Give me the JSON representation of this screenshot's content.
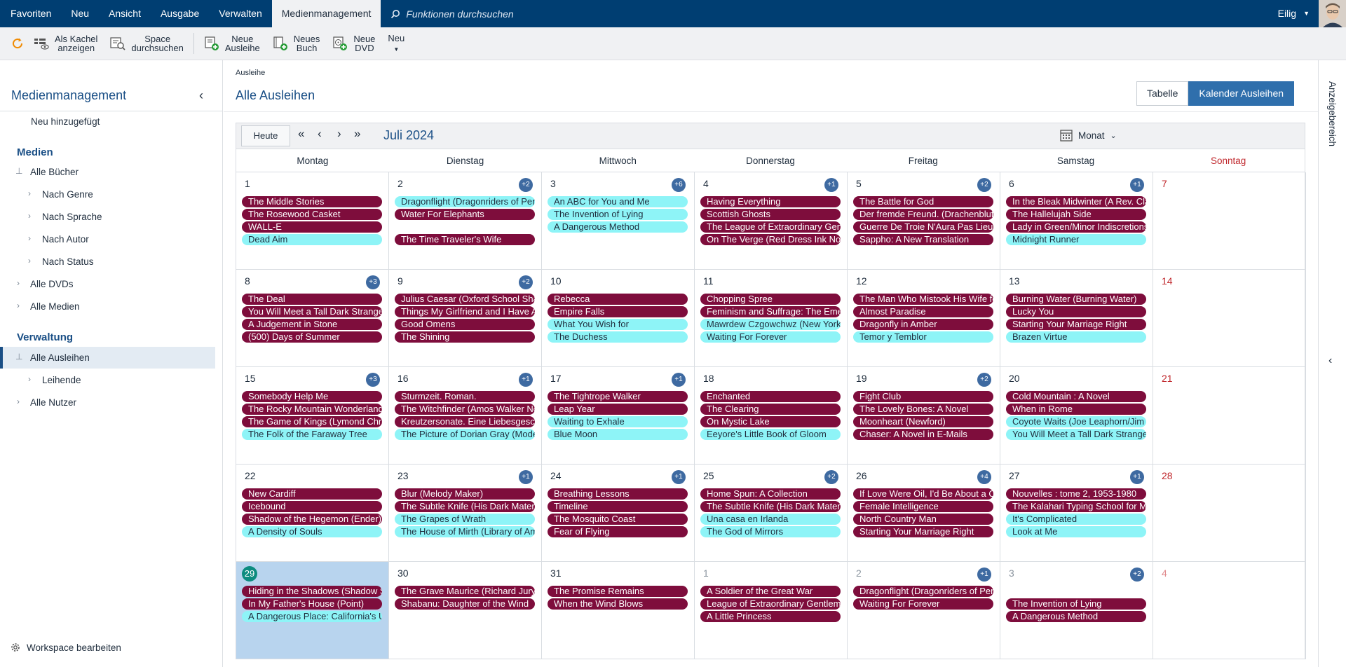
{
  "topnav": {
    "items": [
      "Favoriten",
      "Neu",
      "Ansicht",
      "Ausgabe",
      "Verwalten",
      "Medienmanagement"
    ],
    "active_index": 5,
    "search_placeholder": "Funktionen durchsuchen",
    "user": "Eilig"
  },
  "ribbon": {
    "refresh_icon": "refresh-icon",
    "tile_view": "Als Kachel\nanzeigen",
    "space_search": "Space\ndurchsuchen",
    "new_loan": "Neue\nAusleihe",
    "new_book": "Neues\nBuch",
    "new_dvd": "Neue\nDVD",
    "new_menu": "Neu"
  },
  "sidebar": {
    "title": "Medienmanagement",
    "recent": "Neu hinzugefügt",
    "media_heading": "Medien",
    "all_books": "Alle Bücher",
    "by_genre": "Nach Genre",
    "by_language": "Nach Sprache",
    "by_author": "Nach Autor",
    "by_status": "Nach Status",
    "all_dvds": "Alle DVDs",
    "all_media": "Alle Medien",
    "admin_heading": "Verwaltung",
    "all_loans": "Alle Ausleihen",
    "borrowers": "Leihende",
    "all_users": "Alle Nutzer",
    "footer": "Workspace bearbeiten"
  },
  "main": {
    "breadcrumb": "Ausleihe",
    "title": "Alle Ausleihen",
    "view_table": "Tabelle",
    "view_calendar": "Kalender Ausleihen"
  },
  "calendar": {
    "today_button": "Heute",
    "month_label": "Juli 2024",
    "view_select": "Monat",
    "weekdays": [
      "Montag",
      "Dienstag",
      "Mittwoch",
      "Donnerstag",
      "Freitag",
      "Samstag",
      "Sonntag"
    ],
    "colors": {
      "dark": "#7e0d3c",
      "light": "#8ef4f7",
      "today_bg": "#b8d4ee",
      "sunday": "#c0282d"
    },
    "weeks": [
      [
        {
          "day": "1",
          "events": [
            {
              "t": "The Middle Stories",
              "c": "dark"
            },
            {
              "t": "The Rosewood Casket",
              "c": "dark"
            },
            {
              "t": "WALL-E",
              "c": "dark"
            },
            {
              "t": "Dead Aim",
              "c": "light"
            }
          ]
        },
        {
          "day": "2",
          "more": "+2",
          "events": [
            {
              "t": "Dragonflight (Dragonriders of Pern)",
              "c": "light"
            },
            {
              "t": "Water For Elephants",
              "c": "dark"
            },
            null,
            {
              "t": "The Time Traveler's Wife",
              "c": "dark"
            }
          ]
        },
        {
          "day": "3",
          "more": "+6",
          "events": [
            {
              "t": "An ABC for You and Me",
              "c": "light"
            },
            {
              "t": "The Invention of Lying",
              "c": "light"
            },
            {
              "t": "A Dangerous Method",
              "c": "light"
            }
          ]
        },
        {
          "day": "4",
          "more": "+1",
          "events": [
            {
              "t": "Having Everything",
              "c": "dark"
            },
            {
              "t": "Scottish Ghosts",
              "c": "dark"
            },
            {
              "t": "The League of Extraordinary Gentlemen",
              "c": "dark"
            },
            {
              "t": "On The Verge (Red Dress Ink Novels)",
              "c": "dark"
            }
          ]
        },
        {
          "day": "5",
          "more": "+2",
          "events": [
            {
              "t": "The Battle for God",
              "c": "dark"
            },
            {
              "t": "Der fremde Freund. (Drachenblut)",
              "c": "dark"
            },
            {
              "t": "Guerre De Troie N'Aura Pas Lieu",
              "c": "dark"
            },
            {
              "t": "Sappho: A New Translation",
              "c": "dark"
            }
          ]
        },
        {
          "day": "6",
          "more": "+1",
          "events": [
            {
              "t": "In the Bleak Midwinter (A Rev. Clare Fergusson)",
              "c": "dark"
            },
            {
              "t": "The Hallelujah Side",
              "c": "dark"
            },
            {
              "t": "Lady in Green/Minor Indiscretions",
              "c": "dark"
            },
            {
              "t": "Midnight Runner",
              "c": "light"
            }
          ]
        },
        {
          "day": "7",
          "sunday": true,
          "events": []
        }
      ],
      [
        {
          "day": "8",
          "more": "+3",
          "events": [
            {
              "t": "The Deal",
              "c": "dark"
            },
            {
              "t": "You Will Meet a Tall Dark Stranger",
              "c": "dark"
            },
            {
              "t": "A Judgement in Stone",
              "c": "dark"
            },
            {
              "t": "(500) Days of Summer",
              "c": "dark"
            }
          ]
        },
        {
          "day": "9",
          "more": "+2",
          "events": [
            {
              "t": "Julius Caesar (Oxford School Shakespeare)",
              "c": "dark"
            },
            {
              "t": "Things My Girlfriend and I Have Argued About",
              "c": "dark"
            },
            {
              "t": "Good Omens",
              "c": "dark"
            },
            {
              "t": "The Shining",
              "c": "dark"
            }
          ]
        },
        {
          "day": "10",
          "events": [
            {
              "t": "Rebecca",
              "c": "dark"
            },
            {
              "t": "Empire Falls",
              "c": "dark"
            },
            {
              "t": "What You Wish for",
              "c": "light"
            },
            {
              "t": "The Duchess",
              "c": "light"
            }
          ]
        },
        {
          "day": "11",
          "events": [
            {
              "t": "Chopping Spree",
              "c": "dark"
            },
            {
              "t": "Feminism and Suffrage: The Emergence",
              "c": "dark"
            },
            {
              "t": "Mawrdew Czgowchwz (New York Review)",
              "c": "light"
            },
            {
              "t": "Waiting For Forever",
              "c": "light"
            }
          ]
        },
        {
          "day": "12",
          "events": [
            {
              "t": "The Man Who Mistook His Wife for a Hat",
              "c": "dark"
            },
            {
              "t": "Almost Paradise",
              "c": "dark"
            },
            {
              "t": "Dragonfly in Amber",
              "c": "dark"
            },
            {
              "t": "Temor y Temblor",
              "c": "light"
            }
          ]
        },
        {
          "day": "13",
          "events": [
            {
              "t": "Burning Water (Burning Water)",
              "c": "dark"
            },
            {
              "t": "Lucky You",
              "c": "dark"
            },
            {
              "t": "Starting Your Marriage Right",
              "c": "dark"
            },
            {
              "t": "Brazen Virtue",
              "c": "light"
            }
          ]
        },
        {
          "day": "14",
          "sunday": true,
          "events": []
        }
      ],
      [
        {
          "day": "15",
          "more": "+3",
          "events": [
            {
              "t": "Somebody Help Me",
              "c": "dark"
            },
            {
              "t": "The Rocky Mountain Wonderland",
              "c": "dark"
            },
            {
              "t": "The Game of Kings (Lymond Chronicles)",
              "c": "dark"
            },
            {
              "t": "The Folk of the Faraway Tree",
              "c": "light"
            }
          ]
        },
        {
          "day": "16",
          "more": "+1",
          "events": [
            {
              "t": "Sturmzeit. Roman.",
              "c": "dark"
            },
            {
              "t": "The Witchfinder (Amos Walker Novels)",
              "c": "dark"
            },
            {
              "t": "Kreutzersonate. Eine Liebesgeschichte",
              "c": "dark"
            },
            {
              "t": "The Picture of Dorian Gray (Modern Library)",
              "c": "light"
            }
          ]
        },
        {
          "day": "17",
          "more": "+1",
          "events": [
            {
              "t": "The Tightrope Walker",
              "c": "dark"
            },
            {
              "t": "Leap Year",
              "c": "dark"
            },
            {
              "t": "Waiting to Exhale",
              "c": "light"
            },
            {
              "t": "Blue Moon",
              "c": "light"
            }
          ]
        },
        {
          "day": "18",
          "events": [
            {
              "t": "Enchanted",
              "c": "dark"
            },
            {
              "t": "The Clearing",
              "c": "dark"
            },
            {
              "t": "On Mystic Lake",
              "c": "dark"
            },
            {
              "t": "Eeyore's Little Book of Gloom",
              "c": "light"
            }
          ]
        },
        {
          "day": "19",
          "more": "+2",
          "events": [
            {
              "t": "Fight Club",
              "c": "dark"
            },
            {
              "t": "The Lovely Bones: A Novel",
              "c": "dark"
            },
            {
              "t": "Moonheart (Newford)",
              "c": "dark"
            },
            {
              "t": "Chaser: A Novel in E-Mails",
              "c": "dark"
            }
          ]
        },
        {
          "day": "20",
          "events": [
            {
              "t": "Cold Mountain : A Novel",
              "c": "dark"
            },
            {
              "t": "When in Rome",
              "c": "dark"
            },
            {
              "t": "Coyote Waits (Joe Leaphorn/Jim Chee)",
              "c": "light"
            },
            {
              "t": "You Will Meet a Tall Dark Stranger",
              "c": "light"
            }
          ]
        },
        {
          "day": "21",
          "sunday": true,
          "events": []
        }
      ],
      [
        {
          "day": "22",
          "events": [
            {
              "t": "New Cardiff",
              "c": "dark"
            },
            {
              "t": "Icebound",
              "c": "dark"
            },
            {
              "t": "Shadow of the Hegemon (Ender)",
              "c": "dark"
            },
            {
              "t": "A Density of Souls",
              "c": "light"
            }
          ]
        },
        {
          "day": "23",
          "more": "+1",
          "events": [
            {
              "t": "Blur (Melody Maker)",
              "c": "dark"
            },
            {
              "t": "The Subtle Knife (His Dark Materials)",
              "c": "dark"
            },
            {
              "t": "The Grapes of Wrath",
              "c": "light"
            },
            {
              "t": "The House of Mirth (Library of America)",
              "c": "light"
            }
          ]
        },
        {
          "day": "24",
          "more": "+1",
          "events": [
            {
              "t": "Breathing Lessons",
              "c": "dark"
            },
            {
              "t": "Timeline",
              "c": "dark"
            },
            {
              "t": "The Mosquito Coast",
              "c": "dark"
            },
            {
              "t": "Fear of Flying",
              "c": "dark"
            }
          ]
        },
        {
          "day": "25",
          "more": "+2",
          "events": [
            {
              "t": "Home Spun: A Collection",
              "c": "dark"
            },
            {
              "t": "The Subtle Knife (His Dark Materials)",
              "c": "dark"
            },
            {
              "t": "Una casa en Irlanda",
              "c": "light"
            },
            {
              "t": "The God of Mirrors",
              "c": "light"
            }
          ]
        },
        {
          "day": "26",
          "more": "+4",
          "events": [
            {
              "t": "If Love Were Oil, I'd Be About a Quart Low",
              "c": "dark"
            },
            {
              "t": "Female Intelligence",
              "c": "dark"
            },
            {
              "t": "North Country Man",
              "c": "dark"
            },
            {
              "t": "Starting Your Marriage Right",
              "c": "dark"
            }
          ]
        },
        {
          "day": "27",
          "more": "+1",
          "events": [
            {
              "t": "Nouvelles : tome 2, 1953-1980",
              "c": "dark"
            },
            {
              "t": "The Kalahari Typing School for Men",
              "c": "dark"
            },
            {
              "t": "It's Complicated",
              "c": "light"
            },
            {
              "t": "Look at Me",
              "c": "light"
            }
          ]
        },
        {
          "day": "28",
          "sunday": true,
          "events": []
        }
      ],
      [
        {
          "day": "29",
          "today": true,
          "events": [
            {
              "t": "Hiding in the Shadows (Shadow Series)",
              "c": "dark"
            },
            {
              "t": "In My Father's House (Point)",
              "c": "dark"
            },
            {
              "t": "A Dangerous Place: California's Unsettling Fate",
              "c": "light"
            }
          ]
        },
        {
          "day": "30",
          "events": [
            {
              "t": "The Grave Maurice (Richard Jury Mysteries)",
              "c": "dark"
            },
            {
              "t": "Shabanu: Daughter of the Wind",
              "c": "dark"
            }
          ]
        },
        {
          "day": "31",
          "events": [
            {
              "t": "The Promise Remains",
              "c": "dark"
            },
            {
              "t": "When the Wind Blows",
              "c": "dark"
            }
          ]
        },
        {
          "day": "1",
          "other": true,
          "events": [
            {
              "t": "A Soldier of the Great War",
              "c": "dark"
            },
            {
              "t": "League of Extraordinary Gentlemen",
              "c": "dark"
            },
            {
              "t": "A Little Princess",
              "c": "dark"
            }
          ]
        },
        {
          "day": "2",
          "other": true,
          "more": "+1",
          "events": [
            {
              "t": "Dragonflight (Dragonriders of Pern)",
              "c": "dark"
            },
            {
              "t": "Waiting For Forever",
              "c": "dark"
            }
          ]
        },
        {
          "day": "3",
          "other": true,
          "more": "+2",
          "events": [
            null,
            {
              "t": "The Invention of Lying",
              "c": "dark"
            },
            {
              "t": "A Dangerous Method",
              "c": "dark"
            }
          ]
        },
        {
          "day": "4",
          "other": true,
          "sunday": true,
          "events": []
        }
      ]
    ]
  },
  "right_panel": {
    "label": "Anzeigebereich"
  }
}
